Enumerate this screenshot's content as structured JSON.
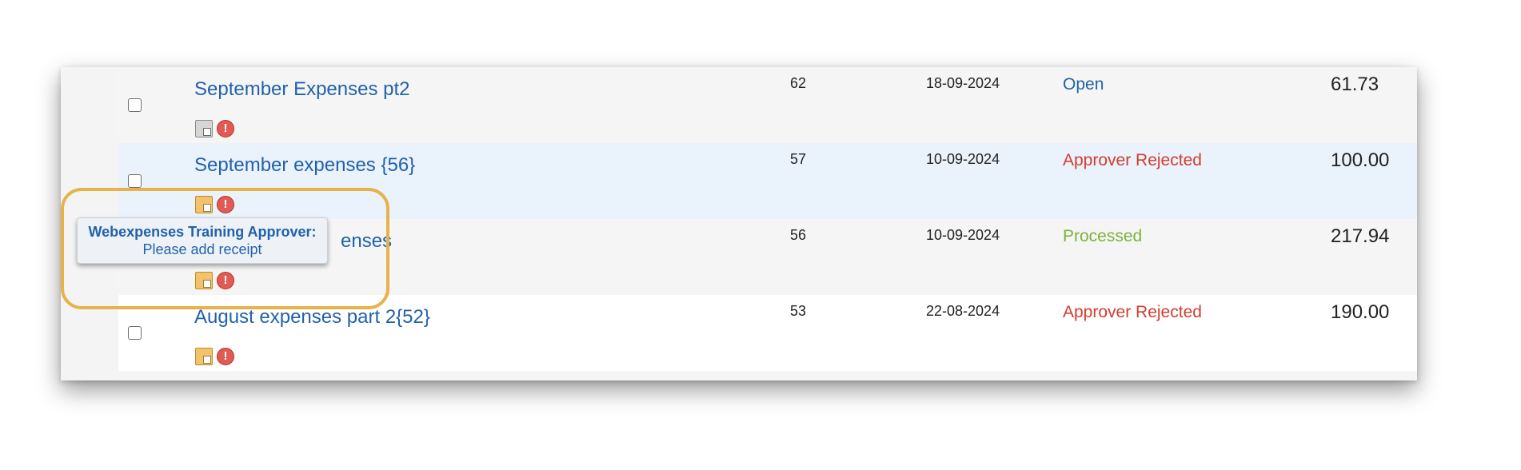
{
  "colors": {
    "link": "#2162ab",
    "status_open": "#2162ab",
    "status_rejected": "#d43c2f",
    "status_processed": "#7cb33a",
    "highlight": "#e8b24a"
  },
  "rows": [
    {
      "title": "September Expenses pt2",
      "number": "62",
      "date": "18-09-2024",
      "status": "Open",
      "amount": "61.73",
      "note_icon": "note-grey-icon",
      "warn_icon": "warning-icon",
      "warn_glyph": "!"
    },
    {
      "title": "September expenses {56}",
      "number": "57",
      "date": "10-09-2024",
      "status": "Approver Rejected",
      "amount": "100.00",
      "note_icon": "note-icon",
      "warn_icon": "warning-icon",
      "warn_glyph": "!"
    },
    {
      "title": "enses",
      "number": "56",
      "date": "10-09-2024",
      "status": "Processed",
      "amount": "217.94",
      "note_icon": "note-icon",
      "warn_icon": "warning-icon",
      "warn_glyph": "!"
    },
    {
      "title": "August expenses part 2{52}",
      "number": "53",
      "date": "22-08-2024",
      "status": "Approver Rejected",
      "amount": "190.00",
      "note_icon": "note-icon",
      "warn_icon": "warning-icon",
      "warn_glyph": "!"
    }
  ],
  "tooltip": {
    "name": "Webexpenses Training Approver:",
    "message": "Please add receipt"
  }
}
